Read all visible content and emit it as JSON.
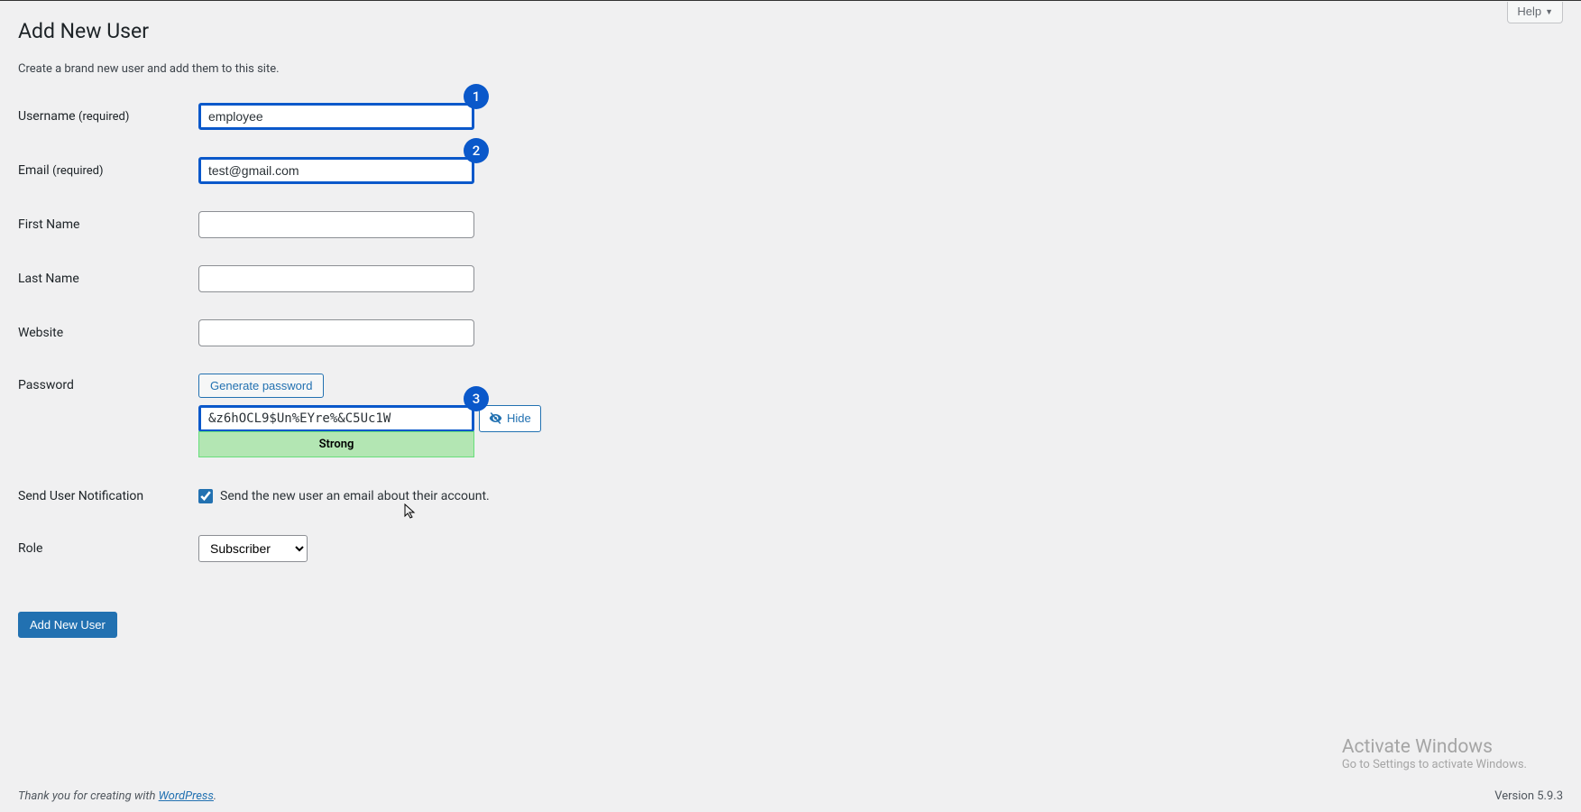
{
  "header": {
    "title": "Add New User",
    "help_label": "Help"
  },
  "subtitle": "Create a brand new user and add them to this site.",
  "steps": {
    "one": "1",
    "two": "2",
    "three": "3"
  },
  "form": {
    "username": {
      "label": "Username",
      "req": "(required)",
      "value": "employee"
    },
    "email": {
      "label": "Email",
      "req": "(required)",
      "value": "test@gmail.com"
    },
    "firstname": {
      "label": "First Name",
      "value": ""
    },
    "lastname": {
      "label": "Last Name",
      "value": ""
    },
    "website": {
      "label": "Website",
      "value": ""
    },
    "password": {
      "label": "Password",
      "generate_btn": "Generate password",
      "value": "&z6hOCL9$Un%EYre%&C5Uc1W",
      "strength": "Strong",
      "hide_btn": "Hide"
    },
    "notification": {
      "label": "Send User Notification",
      "checkbox_label": "Send the new user an email about their account.",
      "checked": true
    },
    "role": {
      "label": "Role",
      "selected": "Subscriber"
    },
    "submit": "Add New User"
  },
  "footer": {
    "left_prefix": "Thank you for creating with ",
    "link_text": "WordPress",
    "left_suffix": ".",
    "version": "Version 5.9.3"
  },
  "watermark": {
    "l1": "Activate Windows",
    "l2": "Go to Settings to activate Windows."
  }
}
